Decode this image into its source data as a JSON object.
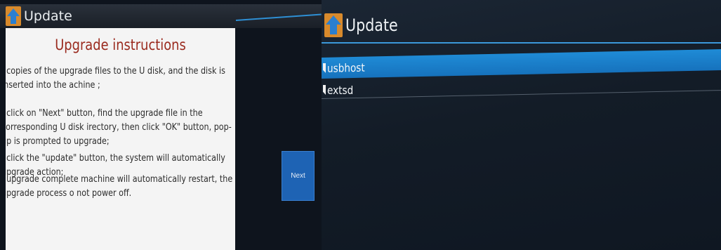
{
  "left_screen": {
    "title": "Update",
    "instructions": {
      "heading": "Upgrade instructions",
      "steps": [
        ". copies of the upgrade files to the U disk, and the disk is inserted into the achine ;",
        ". click on \"Next\" button, find the upgrade file in the corresponding U disk irectory, then click \"OK\" button, pop-up is prompted to upgrade;",
        ". click the \"update\" button, the system will automatically upgrade action;",
        ". upgrade complete machine will automatically restart, the upgrade process o not power off."
      ]
    },
    "next_label": "Next"
  },
  "right_screen": {
    "title": "Update",
    "storage_items": [
      {
        "label": "usbhost",
        "selected": true
      },
      {
        "label": "extsd",
        "selected": false
      }
    ]
  },
  "colors": {
    "accent_blue": "#1e7fcc",
    "heading_red": "#9a2a1e",
    "panel_bg": "#f4f4f4",
    "screen_bg": "#131c27"
  },
  "icons": {
    "app": "upload-arrow-icon",
    "storage": "folder-icon"
  }
}
